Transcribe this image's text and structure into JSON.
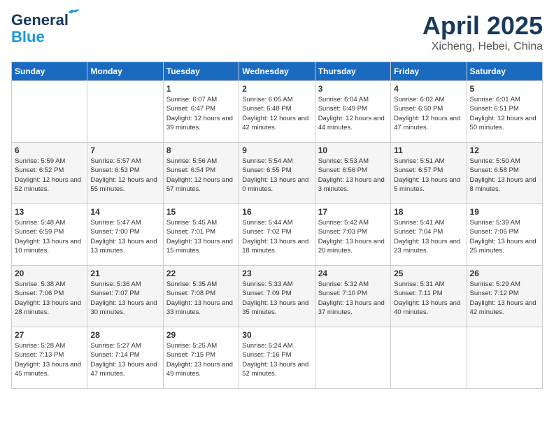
{
  "header": {
    "logo_line1": "General",
    "logo_line2": "Blue",
    "month_title": "April 2025",
    "location": "Xicheng, Hebei, China"
  },
  "days_of_week": [
    "Sunday",
    "Monday",
    "Tuesday",
    "Wednesday",
    "Thursday",
    "Friday",
    "Saturday"
  ],
  "weeks": [
    [
      {
        "day": "",
        "info": ""
      },
      {
        "day": "",
        "info": ""
      },
      {
        "day": "1",
        "info": "Sunrise: 6:07 AM\nSunset: 6:47 PM\nDaylight: 12 hours and 39 minutes."
      },
      {
        "day": "2",
        "info": "Sunrise: 6:05 AM\nSunset: 6:48 PM\nDaylight: 12 hours and 42 minutes."
      },
      {
        "day": "3",
        "info": "Sunrise: 6:04 AM\nSunset: 6:49 PM\nDaylight: 12 hours and 44 minutes."
      },
      {
        "day": "4",
        "info": "Sunrise: 6:02 AM\nSunset: 6:50 PM\nDaylight: 12 hours and 47 minutes."
      },
      {
        "day": "5",
        "info": "Sunrise: 6:01 AM\nSunset: 6:51 PM\nDaylight: 12 hours and 50 minutes."
      }
    ],
    [
      {
        "day": "6",
        "info": "Sunrise: 5:59 AM\nSunset: 6:52 PM\nDaylight: 12 hours and 52 minutes."
      },
      {
        "day": "7",
        "info": "Sunrise: 5:57 AM\nSunset: 6:53 PM\nDaylight: 12 hours and 55 minutes."
      },
      {
        "day": "8",
        "info": "Sunrise: 5:56 AM\nSunset: 6:54 PM\nDaylight: 12 hours and 57 minutes."
      },
      {
        "day": "9",
        "info": "Sunrise: 5:54 AM\nSunset: 6:55 PM\nDaylight: 13 hours and 0 minutes."
      },
      {
        "day": "10",
        "info": "Sunrise: 5:53 AM\nSunset: 6:56 PM\nDaylight: 13 hours and 3 minutes."
      },
      {
        "day": "11",
        "info": "Sunrise: 5:51 AM\nSunset: 6:57 PM\nDaylight: 13 hours and 5 minutes."
      },
      {
        "day": "12",
        "info": "Sunrise: 5:50 AM\nSunset: 6:58 PM\nDaylight: 13 hours and 8 minutes."
      }
    ],
    [
      {
        "day": "13",
        "info": "Sunrise: 5:48 AM\nSunset: 6:59 PM\nDaylight: 13 hours and 10 minutes."
      },
      {
        "day": "14",
        "info": "Sunrise: 5:47 AM\nSunset: 7:00 PM\nDaylight: 13 hours and 13 minutes."
      },
      {
        "day": "15",
        "info": "Sunrise: 5:45 AM\nSunset: 7:01 PM\nDaylight: 13 hours and 15 minutes."
      },
      {
        "day": "16",
        "info": "Sunrise: 5:44 AM\nSunset: 7:02 PM\nDaylight: 13 hours and 18 minutes."
      },
      {
        "day": "17",
        "info": "Sunrise: 5:42 AM\nSunset: 7:03 PM\nDaylight: 13 hours and 20 minutes."
      },
      {
        "day": "18",
        "info": "Sunrise: 5:41 AM\nSunset: 7:04 PM\nDaylight: 13 hours and 23 minutes."
      },
      {
        "day": "19",
        "info": "Sunrise: 5:39 AM\nSunset: 7:05 PM\nDaylight: 13 hours and 25 minutes."
      }
    ],
    [
      {
        "day": "20",
        "info": "Sunrise: 5:38 AM\nSunset: 7:06 PM\nDaylight: 13 hours and 28 minutes."
      },
      {
        "day": "21",
        "info": "Sunrise: 5:36 AM\nSunset: 7:07 PM\nDaylight: 13 hours and 30 minutes."
      },
      {
        "day": "22",
        "info": "Sunrise: 5:35 AM\nSunset: 7:08 PM\nDaylight: 13 hours and 33 minutes."
      },
      {
        "day": "23",
        "info": "Sunrise: 5:33 AM\nSunset: 7:09 PM\nDaylight: 13 hours and 35 minutes."
      },
      {
        "day": "24",
        "info": "Sunrise: 5:32 AM\nSunset: 7:10 PM\nDaylight: 13 hours and 37 minutes."
      },
      {
        "day": "25",
        "info": "Sunrise: 5:31 AM\nSunset: 7:11 PM\nDaylight: 13 hours and 40 minutes."
      },
      {
        "day": "26",
        "info": "Sunrise: 5:29 AM\nSunset: 7:12 PM\nDaylight: 13 hours and 42 minutes."
      }
    ],
    [
      {
        "day": "27",
        "info": "Sunrise: 5:28 AM\nSunset: 7:13 PM\nDaylight: 13 hours and 45 minutes."
      },
      {
        "day": "28",
        "info": "Sunrise: 5:27 AM\nSunset: 7:14 PM\nDaylight: 13 hours and 47 minutes."
      },
      {
        "day": "29",
        "info": "Sunrise: 5:25 AM\nSunset: 7:15 PM\nDaylight: 13 hours and 49 minutes."
      },
      {
        "day": "30",
        "info": "Sunrise: 5:24 AM\nSunset: 7:16 PM\nDaylight: 13 hours and 52 minutes."
      },
      {
        "day": "",
        "info": ""
      },
      {
        "day": "",
        "info": ""
      },
      {
        "day": "",
        "info": ""
      }
    ]
  ]
}
